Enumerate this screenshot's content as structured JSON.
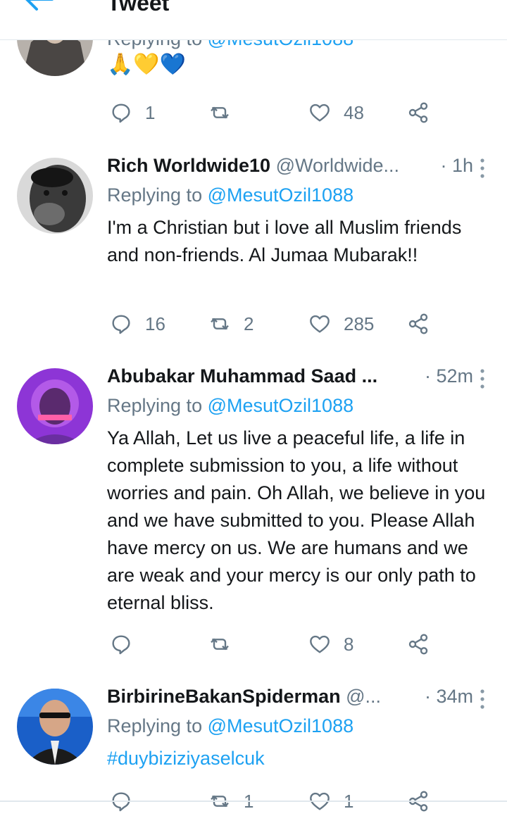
{
  "header": {
    "title": "Tweet"
  },
  "reply_prefix": "Replying to",
  "colors": {
    "accent": "#1da1f2",
    "muted": "#657786",
    "border": "#e1e8ed"
  },
  "tweets": [
    {
      "reply_to": "@MesutOzil1088",
      "text": "🙏💛💙",
      "replies": "1",
      "retweets": "",
      "likes": "48"
    },
    {
      "name": "Rich Worldwide10",
      "handle": "@Worldwide...",
      "time": "· 1h",
      "reply_to": "@MesutOzil1088",
      "text": "I'm a Christian but i love all Muslim friends and non-friends. Al Jumaa Mubarak!!",
      "replies": "16",
      "retweets": "2",
      "likes": "285"
    },
    {
      "name": "Abubakar Muhammad Saad ...",
      "handle": "",
      "time": "· 52m",
      "reply_to": "@MesutOzil1088",
      "text": "Ya Allah, Let us live a peaceful life, a life in complete submission to you, a life without worries and pain. Oh Allah, we believe in you and we have submitted to you. Please Allah have mercy on us. We are humans and we are weak and your mercy is our only path to eternal bliss.",
      "replies": "",
      "retweets": "",
      "likes": "8"
    },
    {
      "name": "BirbirineBakanSpiderman",
      "handle": "@...",
      "time": "· 34m",
      "reply_to": "@MesutOzil1088",
      "text": "#duybiziziyaselcuk",
      "replies": "",
      "retweets": "1",
      "likes": "1"
    }
  ],
  "icons": {
    "back": "arrow-left-icon",
    "caret": "more-vertical-icon",
    "reply": "reply-bubble-icon",
    "retweet": "retweet-icon",
    "like": "heart-icon",
    "share": "share-icon"
  }
}
